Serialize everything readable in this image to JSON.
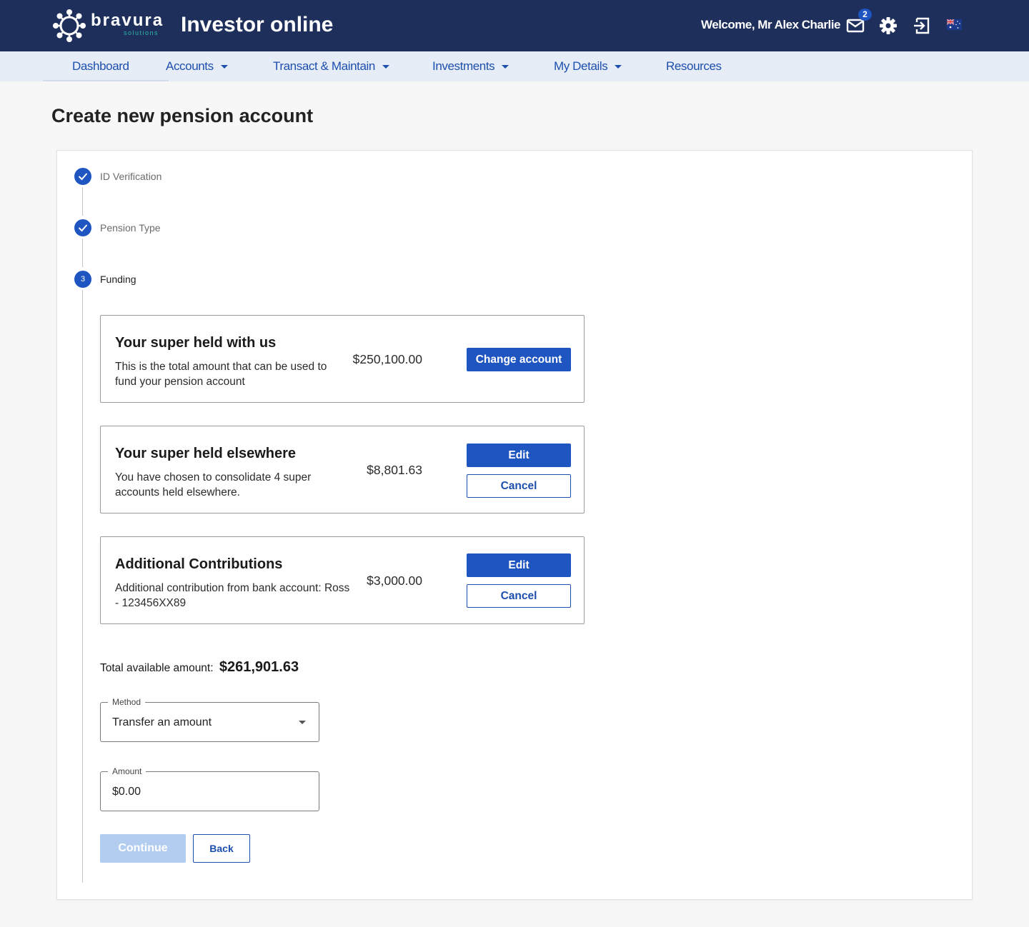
{
  "header": {
    "brand_name": "bravura",
    "brand_sub": "solutions",
    "app_title": "Investor online",
    "welcome": "Welcome, Mr Alex Charlie",
    "mail_count": "2",
    "icons": [
      "mail-icon",
      "gear-icon",
      "logout-icon",
      "australia-flag-icon"
    ]
  },
  "nav": {
    "dashboard": "Dashboard",
    "accounts": "Accounts",
    "transact": "Transact & Maintain",
    "investments": "Investments",
    "my_details": "My Details",
    "resources": "Resources"
  },
  "page": {
    "title": "Create new pension account"
  },
  "steps": [
    {
      "label": "ID Verification",
      "status": "complete"
    },
    {
      "label": "Pension Type",
      "status": "complete"
    },
    {
      "label": "Funding",
      "number": "3",
      "status": "active"
    }
  ],
  "funding": {
    "super_with_us": {
      "title": "Your super held with us",
      "description": "This is the total amount that can be used to fund your pension account",
      "amount": "$250,100.00",
      "button": "Change account"
    },
    "super_elsewhere": {
      "title": "Your super held elsewhere",
      "description": "You have chosen to consolidate 4 super accounts held elsewhere.",
      "amount": "$8,801.63",
      "edit": "Edit",
      "cancel": "Cancel"
    },
    "additional": {
      "title": "Additional Contributions",
      "description": "Additional contribution from bank account: Ross - 123456XX89",
      "amount": "$3,000.00",
      "edit": "Edit",
      "cancel": "Cancel"
    },
    "total_label": "Total available amount:",
    "total_value": "$261,901.63"
  },
  "form": {
    "method_label": "Method",
    "method_value": "Transfer an amount",
    "amount_label": "Amount",
    "amount_value": "$0.00"
  },
  "actions": {
    "continue": "Continue",
    "back": "Back"
  },
  "colors": {
    "header_bg": "#1d2f5a",
    "nav_bg": "#e7edf7",
    "accent": "#1e55c0",
    "brand_teal": "#2fb5a8",
    "disabled_button": "#b3cdf0"
  }
}
